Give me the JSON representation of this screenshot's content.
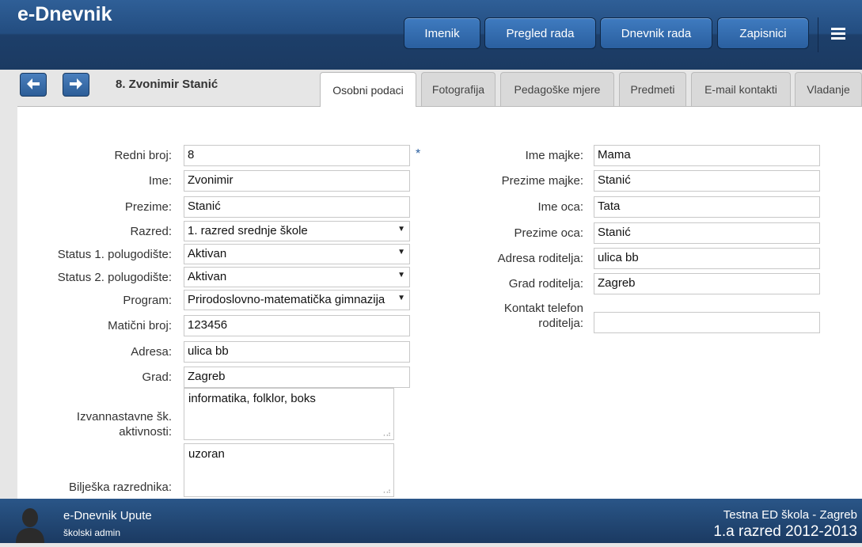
{
  "app": {
    "title": "e-Dnevnik"
  },
  "nav": {
    "items": [
      "Imenik",
      "Pregled rada",
      "Dnevnik rada",
      "Zapisnici"
    ],
    "menu_icon": "hamburger-icon"
  },
  "student": {
    "name": "8. Zvonimir Stanić"
  },
  "tabs": [
    "Osobni podaci",
    "Fotografija",
    "Pedagoške mjere",
    "Predmeti",
    "E-mail kontakti",
    "Vladanje"
  ],
  "form_left": {
    "redni_broj": {
      "label": "Redni broj:",
      "value": "8",
      "required_mark": "*"
    },
    "ime": {
      "label": "Ime:",
      "value": "Zvonimir"
    },
    "prezime": {
      "label": "Prezime:",
      "value": "Stanić"
    },
    "razred": {
      "label": "Razred:",
      "value": "1. razred srednje škole"
    },
    "status1": {
      "label": "Status 1. polugodište:",
      "value": "Aktivan"
    },
    "status2": {
      "label": "Status 2. polugodište:",
      "value": "Aktivan"
    },
    "program": {
      "label": "Program:",
      "value": "Prirodoslovno-matematička gimnazija"
    },
    "maticni_broj": {
      "label": "Matični broj:",
      "value": "123456"
    },
    "adresa": {
      "label": "Adresa:",
      "value": "ulica bb"
    },
    "grad": {
      "label": "Grad:",
      "value": "Zagreb"
    },
    "izvannastavne": {
      "label_line1": "Izvannastavne šk.",
      "label_line2": "aktivnosti:",
      "value": "informatika, folklor, boks"
    },
    "biljeska": {
      "label": "Bilješka razrednika:",
      "value": "uzoran"
    }
  },
  "form_right": {
    "ime_majke": {
      "label": "Ime majke:",
      "value": "Mama"
    },
    "prezime_majke": {
      "label": "Prezime majke:",
      "value": "Stanić"
    },
    "ime_oca": {
      "label": "Ime oca:",
      "value": "Tata"
    },
    "prezime_oca": {
      "label": "Prezime oca:",
      "value": "Stanić"
    },
    "adresa_roditelja": {
      "label": "Adresa roditelja:",
      "value": "ulica bb"
    },
    "grad_roditelja": {
      "label": "Grad roditelja:",
      "value": "Zagreb"
    },
    "kontakt_telefon": {
      "label_line1": "Kontakt telefon",
      "label_line2": "roditelja:",
      "value": ""
    }
  },
  "footer": {
    "title": "e-Dnevnik Upute",
    "role": "školski admin",
    "school": "Testna ED škola - Zagreb",
    "class_year": "1.a razred 2012-2013"
  },
  "colors": {
    "header": "#234d80",
    "footer": "#1b3a62",
    "accent": "#2a5f9f"
  }
}
